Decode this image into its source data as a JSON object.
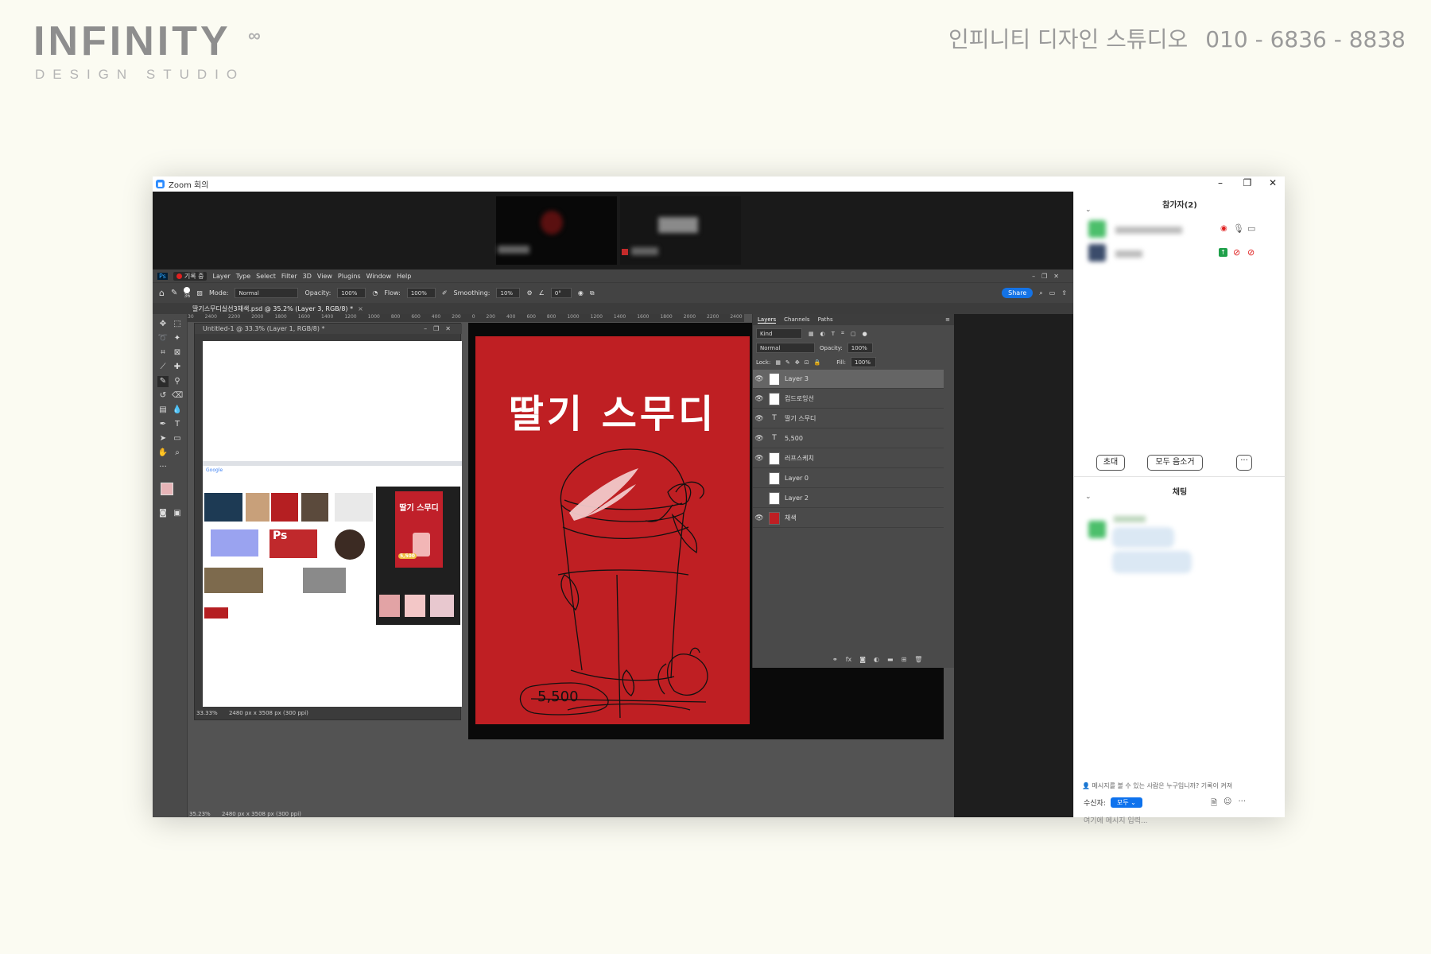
{
  "banner": {
    "logo": "INFINITY",
    "logo_mark": "∞",
    "logo_sub": "DESIGN STUDIO",
    "company_name": "인피니티 디자인 스튜디오",
    "phone": "010 - 6836 - 8838"
  },
  "zoom": {
    "window_title": "Zoom 회의",
    "participants_title": "참가자(2)",
    "invite_button": "초대",
    "mute_all_button": "모두 음소거",
    "more_button": "···",
    "chat_title": "채팅",
    "chat_notice": "메시지를 볼 수 있는 사람은 누구입니까? 기록이 켜져",
    "recipient_label": "수신자:",
    "recipient_value": "모두",
    "message_placeholder": "여기에 메시지 입력..."
  },
  "recording": {
    "label": "기록 중"
  },
  "photoshop": {
    "menu": [
      "Ps",
      "Layer",
      "Type",
      "Select",
      "Filter",
      "3D",
      "View",
      "Plugins",
      "Window",
      "Help"
    ],
    "brush_size": "36",
    "mode_label": "Mode:",
    "mode_value": "Normal",
    "opacity_label": "Opacity:",
    "opacity_value": "100%",
    "flow_label": "Flow:",
    "flow_value": "100%",
    "smoothing_label": "Smoothing:",
    "smoothing_value": "10%",
    "angle_value": "0°",
    "share_button": "Share",
    "doc_tab": "딸기스무디실선3채색.psd @ 35.2% (Layer 3, RGB/8) *",
    "sub_doc_title": "Untitled-1 @ 33.3% (Layer 1, RGB/8) *",
    "sub_status_zoom": "33.33%",
    "sub_status_size": "2480 px x 3508 px (300 ppi)",
    "main_status_zoom": "35.23%",
    "main_status_size": "2480 px x 3508 px (300 ppi)",
    "ruler_marks": [
      "30",
      "2400",
      "2200",
      "2000",
      "1800",
      "1600",
      "1400",
      "1200",
      "1000",
      "800",
      "600",
      "400",
      "200",
      "0",
      "200",
      "400",
      "600",
      "800",
      "1000",
      "1200",
      "1400",
      "1600",
      "1800",
      "2000",
      "2200",
      "2400"
    ],
    "layers_panel": {
      "tabs": [
        "Layers",
        "Channels",
        "Paths"
      ],
      "kind_label": "Kind",
      "blend_value": "Normal",
      "opacity_label": "Opacity:",
      "opacity_value": "100%",
      "lock_label": "Lock:",
      "fill_label": "Fill:",
      "fill_value": "100%",
      "layers": [
        "Layer 3",
        "컵드로잉선",
        "딸기 스무디",
        "5,500",
        "러프스케치",
        "Layer 0",
        "Layer 2",
        "채색"
      ]
    }
  },
  "poster": {
    "title": "딸기 스무디",
    "price": "5,500",
    "background_color": "#bf1f23"
  },
  "search_thumb": {
    "search_engine": "Google",
    "poster_title": "딸기 스무디",
    "poster_price": "5,500"
  }
}
